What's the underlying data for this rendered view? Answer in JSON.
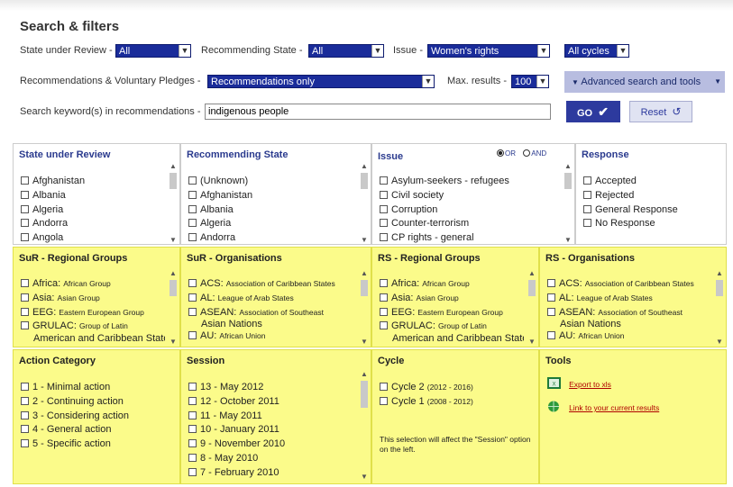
{
  "header": {
    "title": "Search & filters"
  },
  "filters": {
    "state_label": "State under Review -",
    "state_value": "All",
    "recommending_label": "Recommending State -",
    "recommending_value": "All",
    "issue_label": "Issue -",
    "issue_value": "Women's rights",
    "cycles_value": "All cycles",
    "recs_label": "Recommendations & Voluntary Pledges -",
    "recs_value": "Recommendations only",
    "max_label": "Max. results -",
    "max_value": "100",
    "keyword_label": "Search keyword(s) in recommendations -",
    "keyword_value": "indigenous people",
    "advanced_label": "Advanced search and tools",
    "go_label": "GO",
    "reset_label": "Reset"
  },
  "state_under_review": {
    "title": "State under Review",
    "items": [
      "Afghanistan",
      "Albania",
      "Algeria",
      "Andorra",
      "Angola"
    ]
  },
  "recommending_state": {
    "title": "Recommending State",
    "items": [
      "(Unknown)",
      "Afghanistan",
      "Albania",
      "Algeria",
      "Andorra"
    ]
  },
  "issue": {
    "title": "Issue",
    "or_label": "OR",
    "and_label": "AND",
    "items": [
      "Asylum-seekers - refugees",
      "Civil society",
      "Corruption",
      "Counter-terrorism",
      "CP rights - general"
    ]
  },
  "response": {
    "title": "Response",
    "items": [
      "Accepted",
      "Rejected",
      "General Response",
      "No Response"
    ]
  },
  "sur_regional": {
    "title": "SuR - Regional Groups",
    "items": [
      {
        "code": "Africa:",
        "name": "African Group"
      },
      {
        "code": "Asia:",
        "name": "Asian Group"
      },
      {
        "code": "EEG:",
        "name": "Eastern European Group"
      },
      {
        "code": "GRULAC:",
        "name": "Group of Latin",
        "cont": "American and Caribbean States"
      }
    ]
  },
  "sur_orgs": {
    "title": "SuR - Organisations",
    "items": [
      {
        "code": "ACS:",
        "name": "Association of Caribbean States"
      },
      {
        "code": "AL:",
        "name": "League of Arab States"
      },
      {
        "code": "ASEAN:",
        "name": "Association of Southeast",
        "cont": "Asian Nations"
      },
      {
        "code": "AU:",
        "name": "African Union"
      }
    ]
  },
  "rs_regional": {
    "title": "RS - Regional Groups",
    "items": [
      {
        "code": "Africa:",
        "name": "African Group"
      },
      {
        "code": "Asia:",
        "name": "Asian Group"
      },
      {
        "code": "EEG:",
        "name": "Eastern European Group"
      },
      {
        "code": "GRULAC:",
        "name": "Group of Latin",
        "cont": "American and Caribbean States"
      }
    ]
  },
  "rs_orgs": {
    "title": "RS - Organisations",
    "items": [
      {
        "code": "ACS:",
        "name": "Association of Caribbean States"
      },
      {
        "code": "AL:",
        "name": "League of Arab States"
      },
      {
        "code": "ASEAN:",
        "name": "Association of Southeast",
        "cont": "Asian Nations"
      },
      {
        "code": "AU:",
        "name": "African Union"
      }
    ]
  },
  "action_category": {
    "title": "Action Category",
    "items": [
      "1 - Minimal action",
      "2 - Continuing action",
      "3 - Considering action",
      "4 - General action",
      "5 - Specific action"
    ]
  },
  "session": {
    "title": "Session",
    "items": [
      "13 - May 2012",
      "12 - October 2011",
      "11 - May 2011",
      "10 - January 2011",
      "9 - November 2010",
      "8 - May 2010",
      "7 - February 2010"
    ]
  },
  "cycle": {
    "title": "Cycle",
    "items": [
      {
        "label": "Cycle 2",
        "years": "(2012 - 2016)"
      },
      {
        "label": "Cycle 1",
        "years": "(2008 - 2012)"
      }
    ],
    "note": "This selection will affect the \"Session\" option on the left."
  },
  "tools": {
    "title": "Tools",
    "export_label": "Export to xls",
    "link_label": "Link to your current results"
  },
  "colors": {
    "accent": "#1a2c9a",
    "highlight": "#fbfb8a",
    "link": "#b00000"
  }
}
